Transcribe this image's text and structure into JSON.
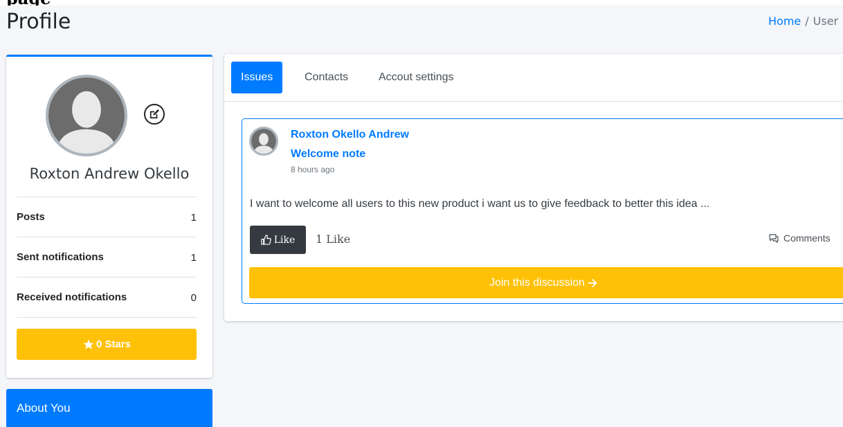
{
  "top_strip_text": "page",
  "header": {
    "title": "Profile",
    "breadcrumb": {
      "home": "Home",
      "separator": "/",
      "current": "User"
    }
  },
  "profile": {
    "name": "Roxton Andrew Okello",
    "stats": [
      {
        "label": "Posts",
        "value": "1"
      },
      {
        "label": "Sent notifications",
        "value": "1"
      },
      {
        "label": "Received notifications",
        "value": "0"
      }
    ],
    "stars_label": "0 Stars",
    "icons": {
      "avatar": "user-silhouette-icon",
      "edit": "edit-icon",
      "star": "star-icon"
    }
  },
  "about": {
    "title": "About You"
  },
  "tabs": [
    {
      "label": "Issues",
      "active": true
    },
    {
      "label": "Contacts",
      "active": false
    },
    {
      "label": "Accout settings",
      "active": false
    }
  ],
  "post": {
    "author": "Roxton Okello Andrew",
    "title": "Welcome note",
    "time": "8 hours ago",
    "body": "I want to welcome all users to this new product i want us to give feedback to better this idea ...",
    "like_label": "Like",
    "like_count": "1 Like",
    "comments_label": "Comments",
    "join_label": "Join this discussion"
  },
  "colors": {
    "primary": "#007bff",
    "warning": "#ffc107",
    "dark": "#343a40",
    "background": "#f4f6f9"
  }
}
